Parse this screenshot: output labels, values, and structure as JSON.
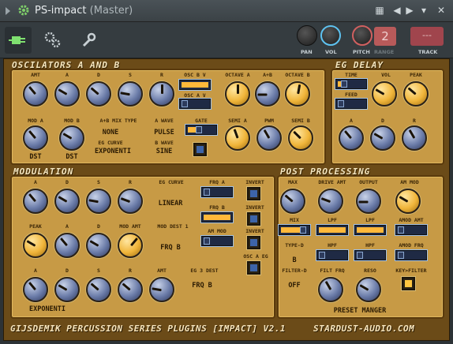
{
  "window": {
    "title": "PS-impact",
    "subtitle": "(Master)"
  },
  "toolbar": {
    "pan_label": "PAN",
    "vol_label": "VOL",
    "pitch_label": "PITCH",
    "range_label": "RANGE",
    "range_value": "2",
    "track_label": "TRACK",
    "track_value": "---"
  },
  "osc": {
    "title": "OSCILATORS A AND B",
    "labels": {
      "amt": "AMT",
      "a": "A",
      "d": "D",
      "s": "S",
      "r": "R",
      "osc_b_v": "OSC B V",
      "osc_a_v": "OSC A V",
      "octave_a": "OCTAVE A",
      "aplusb": "A+B",
      "octave_b": "OCTAVE B",
      "mod_a": "MOD A",
      "mod_b": "MOD B",
      "mix_type": "A+B MIX TYPE",
      "a_wave": "A WAVE",
      "gate": "GATE",
      "semi_a": "SEMI A",
      "pwm": "PWM",
      "semi_b": "SEMI B",
      "eg_curve": "EG CURVE",
      "b_wave": "B WAVE"
    },
    "values": {
      "mix_type": "NONE",
      "a_wave": "PULSE",
      "eg_curve": "EXPONENTI",
      "b_wave": "SINE",
      "mod_a": "DST",
      "mod_b": "DST"
    }
  },
  "egdelay": {
    "title": "EG DELAY",
    "labels": {
      "time": "TIME",
      "vol": "VOL",
      "peak": "PEAK",
      "feed": "FEED",
      "a": "A",
      "d": "D",
      "r": "R"
    }
  },
  "mod": {
    "title": "MODULATION",
    "labels": {
      "a": "A",
      "d": "D",
      "s": "S",
      "r": "R",
      "eg_curve": "EG CURVE",
      "frq_a": "FRQ A",
      "invert": "INVERT",
      "frq_b": "FRQ B",
      "peak": "PEAK",
      "mod_amt": "MOD AMT",
      "mod_dest_1": "MOD DEST 1",
      "am_mod": "AM MOD",
      "osc_a_eg": "OSC A EG",
      "amt": "AMT",
      "eg3_dest": "EG 3 DEST"
    },
    "values": {
      "eg_curve": "LINEAR",
      "mod_dest_1": "FRQ B",
      "eg3_dest": "FRQ B",
      "eg3_curve": "EXPONENTI"
    }
  },
  "post": {
    "title": "POST PROCESSING",
    "labels": {
      "max": "MAX",
      "drive_amt": "DRIVE AMT",
      "output": "OUTPUT",
      "am_mod": "AM MOD",
      "mix": "MIX",
      "lpf": "LPF",
      "lpf2": "LPF",
      "amod_amt": "AMOD AMT",
      "type_d": "TYPE-D",
      "hpf": "HPF",
      "hpf2": "HPF",
      "amod_frq": "AMOD FRQ",
      "filter_d": "FILTER-D",
      "filt_frq": "FILT FRQ",
      "reso": "RESO",
      "key_filter": "KEY>FILTER",
      "preset": "PRESET MANGER"
    },
    "values": {
      "type_d": "B",
      "filter_d": "OFF"
    }
  },
  "footer": {
    "left": "GIJSDEMIK PERCUSSION SERIES PLUGINS [IMPACT] V2.1",
    "right": "STARDUST-AUDIO.COM"
  }
}
